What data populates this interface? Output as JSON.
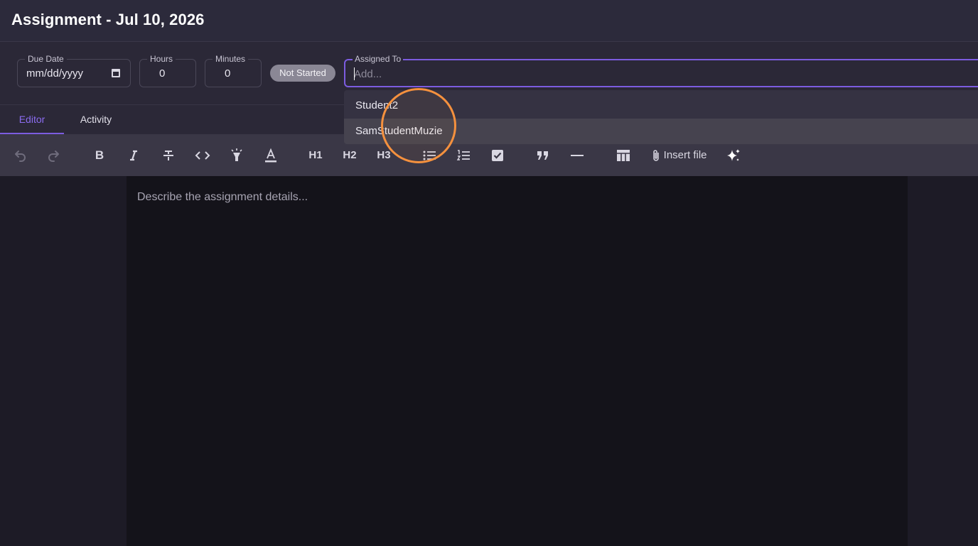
{
  "header": {
    "title": "Assignment - Jul 10, 2026"
  },
  "fields": {
    "due_date": {
      "label": "Due Date",
      "value": "mm/dd/yyyy"
    },
    "hours": {
      "label": "Hours",
      "value": "0"
    },
    "minutes": {
      "label": "Minutes",
      "value": "0"
    },
    "status": "Not Started",
    "assigned_to": {
      "label": "Assigned To",
      "placeholder": "Add...",
      "value": ""
    }
  },
  "dropdown": {
    "options": [
      "Student2",
      "SamStudentMuzie"
    ]
  },
  "tabs": [
    {
      "label": "Editor",
      "active": true
    },
    {
      "label": "Activity",
      "active": false
    }
  ],
  "toolbar": {
    "headings": [
      "H1",
      "H2",
      "H3"
    ],
    "insert_file": "Insert file",
    "icons": [
      "undo-icon",
      "redo-icon",
      "bold-icon",
      "italic-icon",
      "strikethrough-icon",
      "code-icon",
      "highlight-icon",
      "text-color-icon",
      "bullet-list-icon",
      "ordered-list-icon",
      "checkbox-icon",
      "quote-icon",
      "horizontal-rule-icon",
      "table-icon",
      "paperclip-icon",
      "sparkles-icon"
    ]
  },
  "editor": {
    "placeholder": "Describe the assignment details..."
  },
  "colors": {
    "accent": "#7c5ce0",
    "cursor_highlight": "#f5913e"
  }
}
